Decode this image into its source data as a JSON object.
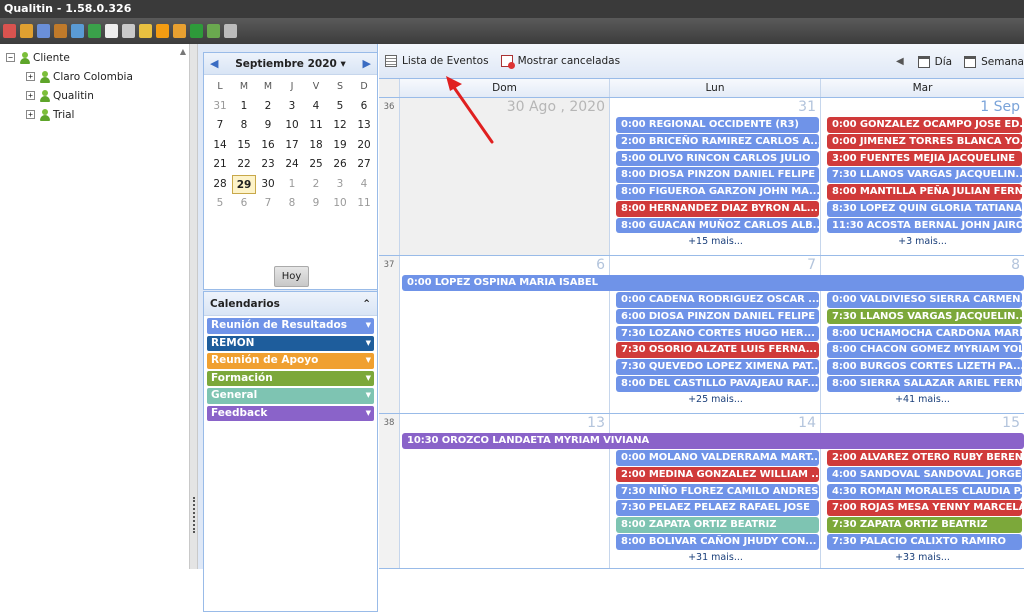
{
  "app": {
    "title": "Qualitin - 1.58.0.326"
  },
  "toolbar_icons": [
    "chart-icon",
    "users-icon",
    "calendar-icon",
    "tools-icon",
    "document-icon",
    "cube-icon",
    "print-icon",
    "books-icon",
    "shield-icon",
    "dot-icon",
    "report-icon",
    "flag-icon",
    "users-icon",
    "cap-icon"
  ],
  "tree": {
    "root": "Cliente",
    "children": [
      "Claro Colombia",
      "Qualitin",
      "Trial"
    ]
  },
  "minical": {
    "month_label": "Septiembre 2020",
    "day_names": [
      "L",
      "M",
      "M",
      "J",
      "V",
      "S",
      "D"
    ],
    "rows": [
      [
        "31",
        "1",
        "2",
        "3",
        "4",
        "5",
        "6"
      ],
      [
        "7",
        "8",
        "9",
        "10",
        "11",
        "12",
        "13"
      ],
      [
        "14",
        "15",
        "16",
        "17",
        "18",
        "19",
        "20"
      ],
      [
        "21",
        "22",
        "23",
        "24",
        "25",
        "26",
        "27"
      ],
      [
        "28",
        "29",
        "30",
        "1",
        "2",
        "3",
        "4"
      ],
      [
        "5",
        "6",
        "7",
        "8",
        "9",
        "10",
        "11"
      ]
    ],
    "today_button": "Hoy"
  },
  "calendars": {
    "title": "Calendarios",
    "items": [
      {
        "label": "Reunión de Resultados",
        "color": "#6f93e8"
      },
      {
        "label": "REMON",
        "color": "#1e5d9c"
      },
      {
        "label": "Reunión de Apoyo",
        "color": "#f0a030"
      },
      {
        "label": "Formación",
        "color": "#7ca83a"
      },
      {
        "label": "General",
        "color": "#7ec4b2"
      },
      {
        "label": "Feedback",
        "color": "#8a63c9"
      }
    ]
  },
  "main_toolbar": {
    "list_events": "Lista de Eventos",
    "show_cancelled": "Mostrar canceladas",
    "day": "Día",
    "week": "Semana"
  },
  "day_headers": [
    "Dom",
    "Lun",
    "Mar"
  ],
  "weeks": [
    {
      "number": "36",
      "days": [
        "30 Ago , 2020",
        "31",
        "1 Sep"
      ],
      "allday": [],
      "events": {
        "lun": [
          {
            "text": "0:00 REGIONAL OCCIDENTE (R3)",
            "color": "#6f93e8"
          },
          {
            "text": "2:00 BRICEÑO RAMIREZ CARLOS A...",
            "color": "#6f93e8"
          },
          {
            "text": "5:00 OLIVO RINCON CARLOS JULIO",
            "color": "#6f93e8"
          },
          {
            "text": "8:00 DIOSA PINZON DANIEL FELIPE",
            "color": "#6f93e8"
          },
          {
            "text": "8:00 FIGUEROA GARZON JOHN MA...",
            "color": "#6f93e8"
          },
          {
            "text": "8:00 HERNANDEZ DIAZ BYRON AL...",
            "color": "#d03a3a"
          },
          {
            "text": "8:00 GUACAN MUÑOZ CARLOS ALB...",
            "color": "#6f93e8"
          }
        ],
        "lun_more": "+15 mais...",
        "mar": [
          {
            "text": "0:00 GONZALEZ OCAMPO JOSE ED...",
            "color": "#d03a3a"
          },
          {
            "text": "0:00 JIMENEZ TORRES BLANCA YO...",
            "color": "#d03a3a"
          },
          {
            "text": "3:00 FUENTES MEJIA JACQUELINE",
            "color": "#d03a3a"
          },
          {
            "text": "7:30 LLANOS VARGAS JACQUELIN...",
            "color": "#6f93e8"
          },
          {
            "text": "8:00 MANTILLA PEÑA JULIAN FERN...",
            "color": "#d03a3a"
          },
          {
            "text": "8:30 LOPEZ QUIN GLORIA TATIANA",
            "color": "#6f93e8"
          },
          {
            "text": "11:30 ACOSTA BERNAL JOHN JAIRO",
            "color": "#6f93e8"
          }
        ],
        "mar_more": "+3 mais..."
      }
    },
    {
      "number": "37",
      "days": [
        "6",
        "7",
        "8"
      ],
      "allday": [
        {
          "text": "0:00 LOPEZ OSPINA MARIA ISABEL",
          "color": "#6f93e8"
        }
      ],
      "events": {
        "lun": [
          {
            "text": "0:00 CADENA RODRIGUEZ OSCAR ...",
            "color": "#6f93e8"
          },
          {
            "text": "6:00 DIOSA PINZON DANIEL FELIPE",
            "color": "#6f93e8"
          },
          {
            "text": "7:30 LOZANO CORTES HUGO HER...",
            "color": "#6f93e8"
          },
          {
            "text": "7:30 OSORIO ALZATE LUIS FERNA...",
            "color": "#d03a3a"
          },
          {
            "text": "7:30 QUEVEDO LOPEZ XIMENA PAT...",
            "color": "#6f93e8"
          },
          {
            "text": "8:00 DEL CASTILLO PAVAJEAU RAF...",
            "color": "#6f93e8"
          }
        ],
        "lun_more": "+25 mais...",
        "mar": [
          {
            "text": "0:00 VALDIVIESO SIERRA CARMEN...",
            "color": "#6f93e8"
          },
          {
            "text": "7:30 LLANOS VARGAS JACQUELIN...",
            "color": "#7ca83a"
          },
          {
            "text": "8:00 UCHAMOCHA CARDONA MARI...",
            "color": "#6f93e8"
          },
          {
            "text": "8:00 CHACON GOMEZ MYRIAM YOL...",
            "color": "#6f93e8"
          },
          {
            "text": "8:00 BURGOS CORTES LIZETH PA...",
            "color": "#6f93e8"
          },
          {
            "text": "8:00 SIERRA SALAZAR ARIEL FERN...",
            "color": "#6f93e8"
          }
        ],
        "mar_more": "+41 mais..."
      }
    },
    {
      "number": "38",
      "days": [
        "13",
        "14",
        "15"
      ],
      "allday": [
        {
          "text": "10:30 OROZCO LANDAETA MYRIAM VIVIANA",
          "color": "#8a63c9"
        }
      ],
      "events": {
        "lun": [
          {
            "text": "0:00 MOLANO VALDERRAMA MART...",
            "color": "#6f93e8"
          },
          {
            "text": "2:00 MEDINA GONZALEZ WILLIAM ...",
            "color": "#d03a3a"
          },
          {
            "text": "7:30 NIÑO FLOREZ CAMILO ANDRES",
            "color": "#6f93e8"
          },
          {
            "text": "7:30 PELAEZ PELAEZ RAFAEL JOSE",
            "color": "#6f93e8"
          },
          {
            "text": "8:00 ZAPATA ORTIZ BEATRIZ",
            "color": "#7ec4b2"
          },
          {
            "text": "8:00 BOLIVAR CAÑON JHUDY CON...",
            "color": "#6f93e8"
          }
        ],
        "lun_more": "+31 mais...",
        "mar": [
          {
            "text": "2:00 ALVAREZ OTERO RUBY BERENA",
            "color": "#d03a3a"
          },
          {
            "text": "4:00 SANDOVAL SANDOVAL JORGE...",
            "color": "#6f93e8"
          },
          {
            "text": "4:30 ROMAN MORALES CLAUDIA P...",
            "color": "#6f93e8"
          },
          {
            "text": "7:00 ROJAS MESA YENNY MARCELA",
            "color": "#d03a3a"
          },
          {
            "text": "7:30 ZAPATA ORTIZ BEATRIZ",
            "color": "#7ca83a"
          },
          {
            "text": "7:30 PALACIO CALIXTO RAMIRO",
            "color": "#6f93e8"
          }
        ],
        "mar_more": "+33 mais..."
      }
    }
  ]
}
